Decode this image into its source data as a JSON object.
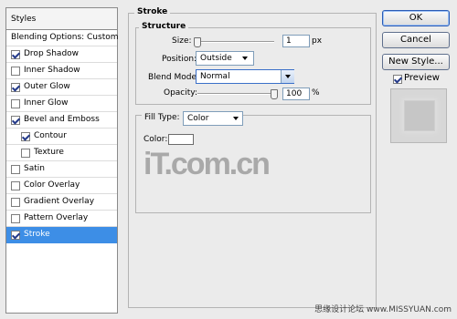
{
  "left_panel": {
    "header": "Styles",
    "items": [
      {
        "label": "Blending Options: Custom",
        "checkbox": false,
        "checked": false,
        "selected": false,
        "indent": 0
      },
      {
        "label": "Drop Shadow",
        "checkbox": true,
        "checked": true,
        "selected": false,
        "indent": 0
      },
      {
        "label": "Inner Shadow",
        "checkbox": true,
        "checked": false,
        "selected": false,
        "indent": 0
      },
      {
        "label": "Outer Glow",
        "checkbox": true,
        "checked": true,
        "selected": false,
        "indent": 0
      },
      {
        "label": "Inner Glow",
        "checkbox": true,
        "checked": false,
        "selected": false,
        "indent": 0
      },
      {
        "label": "Bevel and Emboss",
        "checkbox": true,
        "checked": true,
        "selected": false,
        "indent": 0
      },
      {
        "label": "Contour",
        "checkbox": true,
        "checked": true,
        "selected": false,
        "indent": 1
      },
      {
        "label": "Texture",
        "checkbox": true,
        "checked": false,
        "selected": false,
        "indent": 1
      },
      {
        "label": "Satin",
        "checkbox": true,
        "checked": false,
        "selected": false,
        "indent": 0
      },
      {
        "label": "Color Overlay",
        "checkbox": true,
        "checked": false,
        "selected": false,
        "indent": 0
      },
      {
        "label": "Gradient Overlay",
        "checkbox": true,
        "checked": false,
        "selected": false,
        "indent": 0
      },
      {
        "label": "Pattern Overlay",
        "checkbox": true,
        "checked": false,
        "selected": false,
        "indent": 0
      },
      {
        "label": "Stroke",
        "checkbox": true,
        "checked": true,
        "selected": true,
        "indent": 0
      }
    ]
  },
  "stroke": {
    "title": "Stroke",
    "structure": {
      "title": "Structure",
      "size_label": "Size:",
      "size_value": "1",
      "size_unit": "px",
      "size_level": 0.0,
      "position_label": "Position:",
      "position_value": "Outside",
      "blend_label": "Blend Mode:",
      "blend_value": "Normal",
      "opacity_label": "Opacity:",
      "opacity_value": "100",
      "opacity_unit": "%",
      "opacity_level": 1.0
    },
    "fill": {
      "type_label": "Fill Type:",
      "type_value": "Color",
      "color_label": "Color:",
      "color_value": "#ffffff"
    }
  },
  "buttons": {
    "ok": "OK",
    "cancel": "Cancel",
    "new_style": "New Style...",
    "preview": "Preview",
    "preview_checked": true
  },
  "watermark": "iT.com.cn",
  "footer": "思缘设计论坛 www.MISSYUAN.com",
  "colors": {
    "selection": "#3d8ee6",
    "background": "#ebebeb",
    "accent_border": "#2a5bb5"
  }
}
